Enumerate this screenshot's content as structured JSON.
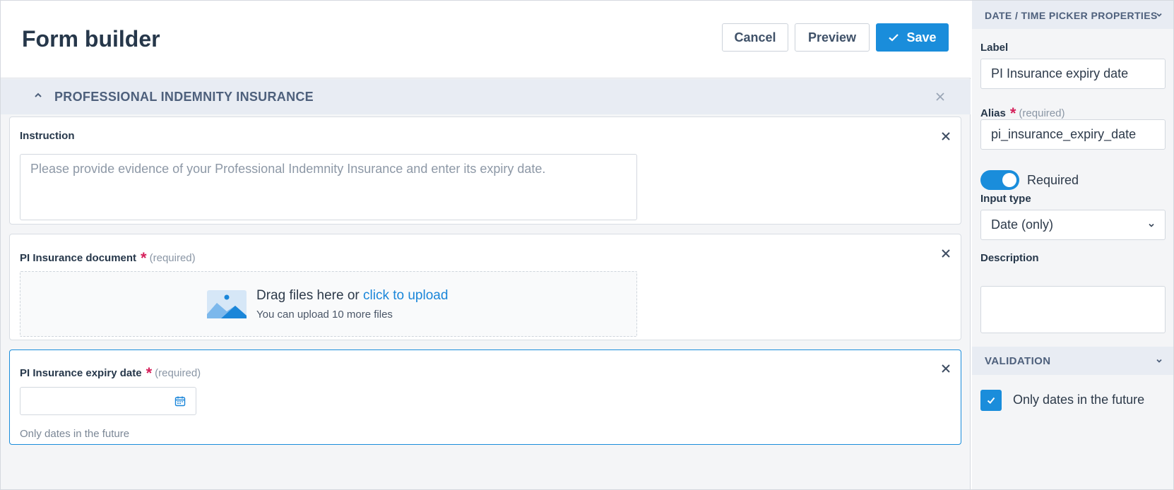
{
  "header": {
    "title": "Form builder",
    "cancel_label": "Cancel",
    "preview_label": "Preview",
    "save_label": "Save"
  },
  "section": {
    "title": "PROFESSIONAL INDEMNITY INSURANCE"
  },
  "fields": {
    "instruction": {
      "label": "Instruction",
      "placeholder": "Please provide evidence of your Professional Indemnity Insurance and enter its expiry date."
    },
    "document": {
      "label": "PI Insurance document",
      "required_star": "*",
      "required_text": "(required)",
      "drop_text": "Drag files here or",
      "upload_link": "click to upload",
      "upload_hint": "You can upload 10 more files"
    },
    "expiry": {
      "label": "PI Insurance expiry date",
      "required_star": "*",
      "required_text": "(required)",
      "hint": "Only dates in the future"
    }
  },
  "panel": {
    "title": "DATE / TIME PICKER PROPERTIES",
    "label_title": "Label",
    "label_value": "PI Insurance expiry date",
    "alias_title": "Alias",
    "alias_star": "*",
    "alias_required": "(required)",
    "alias_value": "pi_insurance_expiry_date",
    "required_toggle": {
      "label": "Required",
      "on": true
    },
    "input_type_title": "Input type",
    "input_type_value": "Date (only)",
    "description_title": "Description",
    "validation_title": "VALIDATION",
    "validation_option": {
      "label": "Only dates in the future",
      "checked": true
    }
  },
  "colors": {
    "accent": "#1a8ddb",
    "required": "#d51f5a",
    "section_bg": "#e8ecf3"
  },
  "icons": [
    "check-icon",
    "chevron-up-icon",
    "close-icon",
    "image-icon",
    "calendar-icon",
    "chevron-down-icon"
  ]
}
